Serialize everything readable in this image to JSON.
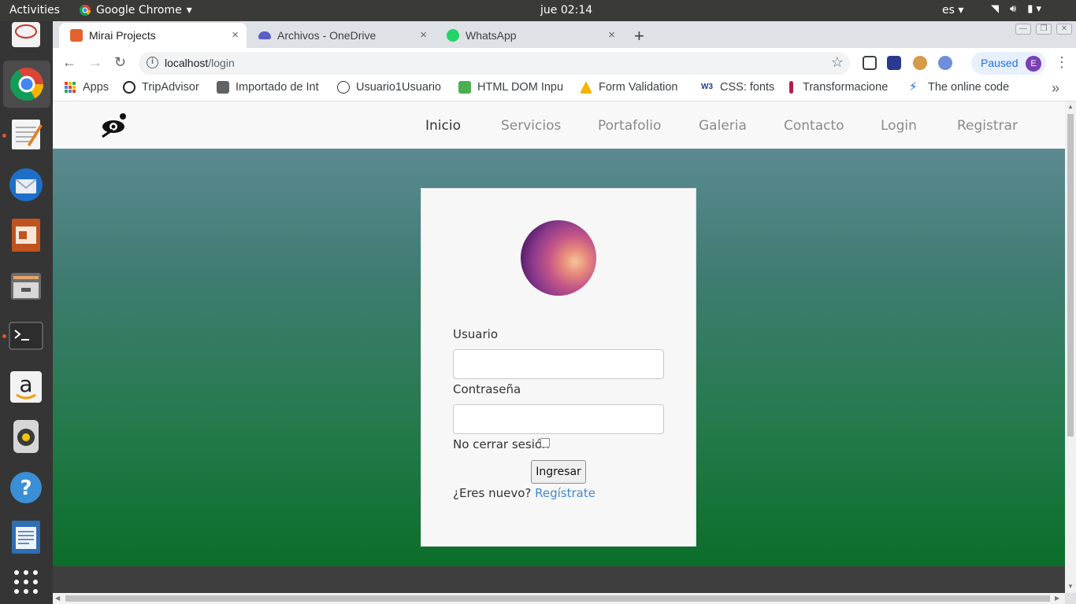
{
  "system": {
    "activities": "Activities",
    "app_name": "Google Chrome",
    "clock": "jue 02:14",
    "language": "es",
    "dock": [
      "terminal-like-icon",
      "chrome-icon",
      "text-editor-icon",
      "thunderbird-icon",
      "impress-icon",
      "files-icon",
      "terminal-icon",
      "amazon-icon",
      "speaker-icon",
      "help-icon",
      "writer-icon",
      "app-grid-icon"
    ]
  },
  "tabs": [
    {
      "title": "Mirai Projects",
      "close": "×"
    },
    {
      "title": "Archivos - OneDrive",
      "close": "×"
    },
    {
      "title": "WhatsApp",
      "close": "×"
    }
  ],
  "new_tab": "+",
  "omnibox": {
    "host": "localhost",
    "path": "/login",
    "info": "i"
  },
  "profile": {
    "status": "Paused",
    "initial": "E"
  },
  "bookmarks": [
    {
      "label": "Apps"
    },
    {
      "label": "TripAdvisor"
    },
    {
      "label": "Importado de Int"
    },
    {
      "label": "Usuario1Usuario"
    },
    {
      "label": "HTML DOM Inpu"
    },
    {
      "label": "Form Validation"
    },
    {
      "label": "CSS: fonts"
    },
    {
      "label": "Transformacione"
    },
    {
      "label": "The online code"
    }
  ],
  "navbar": {
    "links": [
      "Inicio",
      "Servicios",
      "Portafolio",
      "Galeria",
      "Contacto",
      "Login",
      "Registrar"
    ],
    "active": "Inicio"
  },
  "login": {
    "user_label": "Usuario",
    "user_value": "",
    "password_label": "Contraseña",
    "password_value": "",
    "remember_label": "No cerrar sesión",
    "remember_checked": false,
    "submit_label": "Ingresar",
    "new_user_text": "¿Eres nuevo?",
    "register_link": "Regístrate"
  }
}
